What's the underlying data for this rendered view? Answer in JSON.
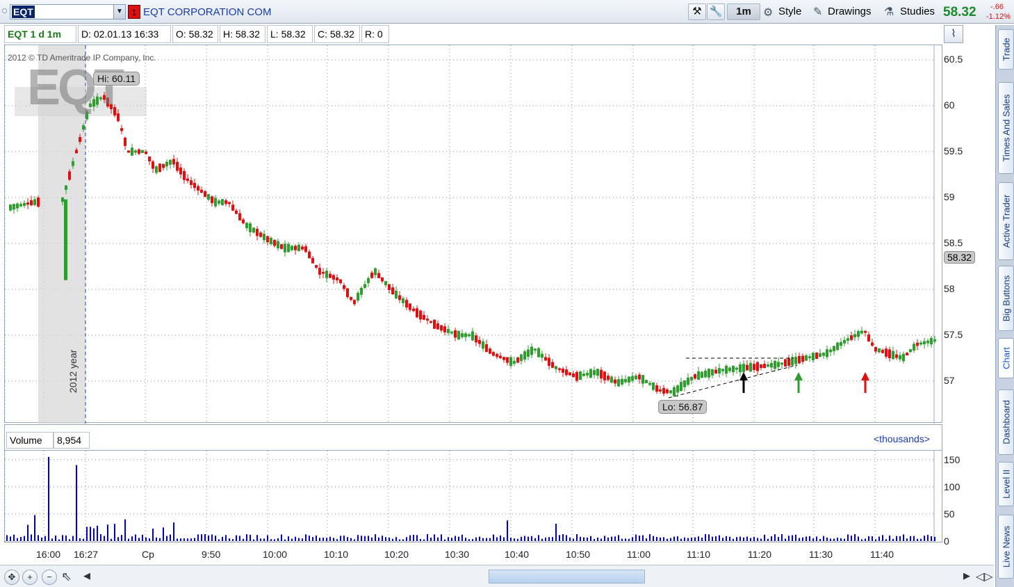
{
  "toolbar": {
    "symbol": "EQT",
    "link_number": "1",
    "company": "EQT CORPORATION COM",
    "interval": "1m",
    "style": "Style",
    "drawings": "Drawings",
    "studies": "Studies",
    "last_price": "58.32",
    "change": "-.66",
    "change_pct": "-1.12%"
  },
  "info": {
    "title": "EQT 1 d 1m",
    "date": "D: 02.01.13 16:33",
    "open": "O: 58.32",
    "high": "H: 58.32",
    "low": "L: 58.32",
    "close": "C: 58.32",
    "range": "R: 0"
  },
  "chart": {
    "watermark": "EQT",
    "copyright": "2012 © TD Ameritrade IP Company, Inc.",
    "year_marker": "2012 year",
    "hi_label": "Hi: 60.11",
    "lo_label": "Lo: 56.87",
    "price_tag": "58.32",
    "y_ticks": [
      "60.5",
      "60",
      "59.5",
      "59",
      "58.5",
      "58",
      "57.5",
      "57"
    ],
    "x_ticks": [
      "16:00",
      "16:27",
      "Cp",
      "9:50",
      "10:00",
      "10:10",
      "10:20",
      "10:30",
      "10:40",
      "10:50",
      "11:00",
      "11:10",
      "11:20",
      "11:30",
      "11:40"
    ],
    "colors": {
      "up": "#2e9e2e",
      "down": "#e01010",
      "volume": "#0000cc",
      "grid": "#888888"
    }
  },
  "volume": {
    "label": "Volume",
    "value": "8,954",
    "units": "<thousands>",
    "y_ticks": [
      "150",
      "100",
      "50",
      "0"
    ]
  },
  "sidebar": {
    "tabs": [
      "Trade",
      "Times And Sales",
      "Active Trader",
      "Big Buttons",
      "Chart",
      "Dashboard",
      "Level II",
      "Live News"
    ]
  },
  "chart_data": {
    "type": "candlestick",
    "title": "EQT 1 d 1m",
    "ylim": [
      56.5,
      60.6
    ],
    "high": 60.11,
    "low": 56.87,
    "last": 58.32,
    "volume_ylim": [
      0,
      160
    ],
    "volume_units": "thousands"
  }
}
